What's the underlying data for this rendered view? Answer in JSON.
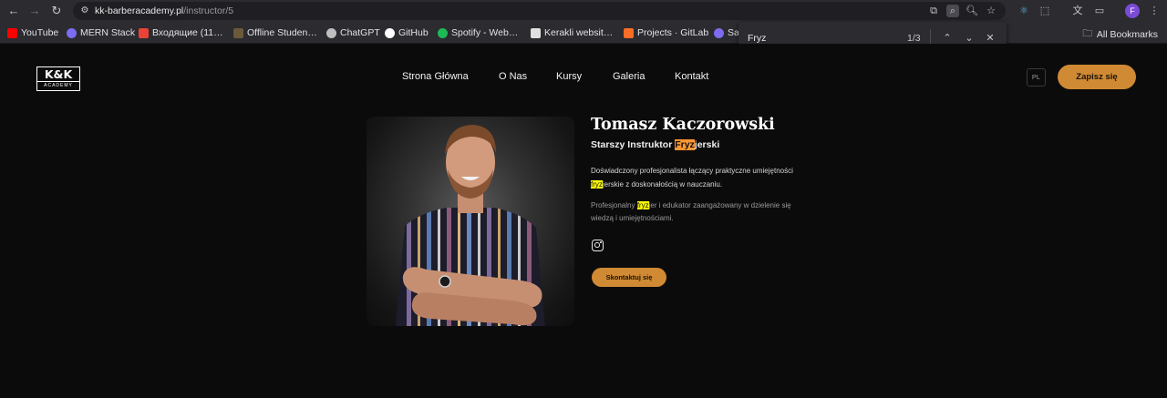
{
  "browser": {
    "url_host": "kk-barberacademy.pl",
    "url_path": "/instructor/5",
    "avatar_letter": "F",
    "bookmarks": [
      {
        "label": "YouTube",
        "color": "#ff0000"
      },
      {
        "label": "MERN Stack",
        "color": "#7c6cf0"
      },
      {
        "label": "Входящие (11…",
        "color": "#ea4335"
      },
      {
        "label": "Offline Studen…",
        "color": "#6b5a3a"
      },
      {
        "label": "ChatGPT",
        "color": "#bfbfbf"
      },
      {
        "label": "GitHub",
        "color": "#ffffff"
      },
      {
        "label": "Spotify - Web…",
        "color": "#1db954"
      },
      {
        "label": "Kerakli websit…",
        "color": "#e0e0e0"
      },
      {
        "label": "Projects · GitLab",
        "color": "#fc6d26"
      },
      {
        "label": "Sa",
        "color": "#7c6cf0"
      }
    ],
    "all_bookmarks": "All Bookmarks"
  },
  "find": {
    "query": "Fryz",
    "count": "1/3"
  },
  "site": {
    "logo_main": "K&K",
    "logo_sub": "ACADEMY",
    "nav": [
      "Strona Główna",
      "O Nas",
      "Kursy",
      "Galeria",
      "Kontakt"
    ],
    "lang": "PL",
    "cta": "Zapisz się"
  },
  "instructor": {
    "name": "Tomasz Kaczorowski",
    "role_pre": "Starszy Instruktor ",
    "role_hl": "Fryz",
    "role_post": "jerski",
    "p1_pre": "Doświadczony profesjonalista łączący praktyczne umiejętności ",
    "p1_hl": "fryz",
    "p1_post": "jerskie z doskonałością w nauczaniu.",
    "p2_pre": "Profesjonalny ",
    "p2_hl": "fryz",
    "p2_post": "jer i edukator zaangażowany w dzielenie się wiedzą i umiejętnościami.",
    "contact": "Skontaktuj się"
  }
}
